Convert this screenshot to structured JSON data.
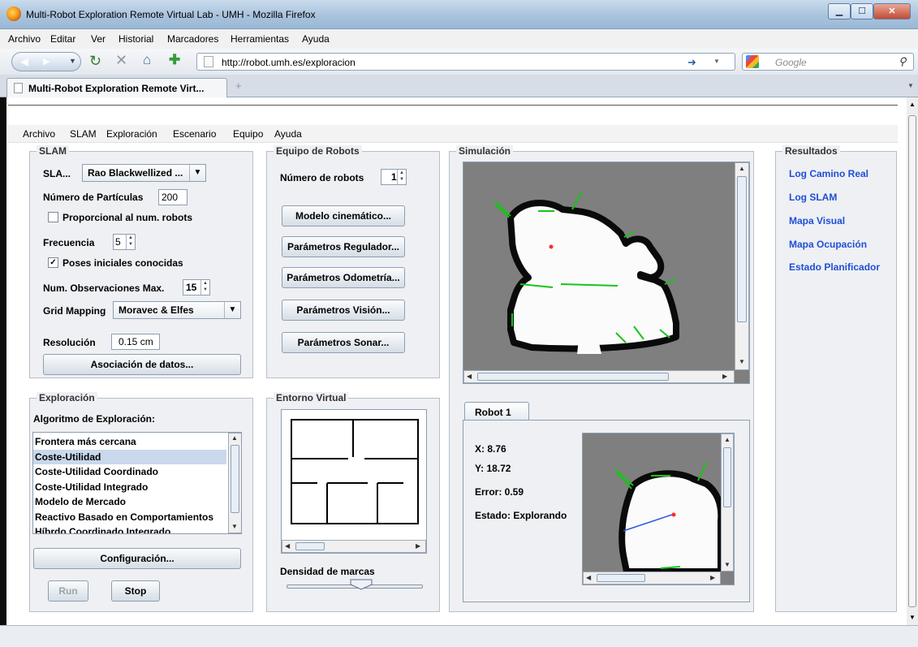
{
  "window": {
    "title": "Multi-Robot Exploration Remote Virtual Lab - UMH - Mozilla Firefox"
  },
  "browser_menu": [
    "Archivo",
    "Editar",
    "Ver",
    "Historial",
    "Marcadores",
    "Herramientas",
    "Ayuda"
  ],
  "nav": {
    "url": "http://robot.umh.es/exploracion",
    "search_placeholder": "Google"
  },
  "tab": {
    "title": "Multi-Robot Exploration Remote Virt..."
  },
  "app_menu": [
    "Archivo",
    "SLAM",
    "Exploración",
    "Escenario",
    "Equipo",
    "Ayuda"
  ],
  "slam": {
    "title": "SLAM",
    "sla_label": "SLA...",
    "sla_value": "Rao Blackwellized ...",
    "particles_label": "Número de Partículas",
    "particles_value": "200",
    "proportional_label": "Proporcional al num. robots",
    "proportional_checked": false,
    "frequency_label": "Frecuencia",
    "frequency_value": "5",
    "initial_poses_label": "Poses iniciales conocidas",
    "initial_poses_checked": true,
    "max_obs_label": "Num. Observaciones Max.",
    "max_obs_value": "15",
    "grid_label": "Grid Mapping",
    "grid_value": "Moravec & Elfes",
    "resolution_label": "Resolución",
    "resolution_value": "0.15 cm",
    "data_assoc_button": "Asociación de datos..."
  },
  "team": {
    "title": "Equipo de Robots",
    "num_robots_label": "Número de robots",
    "num_robots_value": "1",
    "buttons": [
      "Modelo cinemático...",
      "Parámetros Regulador...",
      "Parámetros Odometría...",
      "Parámetros Visión...",
      "Parámetros Sonar..."
    ]
  },
  "simulation": {
    "title": "Simulación"
  },
  "results": {
    "title": "Resultados",
    "links": [
      "Log Camino Real",
      "Log SLAM",
      "Mapa Visual",
      "Mapa Ocupación",
      "Estado Planificador"
    ]
  },
  "exploration": {
    "title": "Exploración",
    "algo_label": "Algoritmo de Exploración:",
    "algorithms": [
      "Frontera más cercana",
      "Coste-Utilidad",
      "Coste-Utilidad Coordinado",
      "Coste-Utilidad Integrado",
      "Modelo de Mercado",
      "Reactivo Basado en Comportamientos",
      "Híbrdo Coordinado Integrado"
    ],
    "selected_index": 1,
    "config_button": "Configuración...",
    "run_button": "Run",
    "stop_button": "Stop"
  },
  "virtual_env": {
    "title": "Entorno Virtual",
    "density_label": "Densidad de marcas",
    "density_value": 0.55
  },
  "robot": {
    "tab": "Robot 1",
    "x": "X: 8.76",
    "y": "Y: 18.72",
    "error": "Error: 0.59",
    "state": "Estado: Explorando"
  }
}
